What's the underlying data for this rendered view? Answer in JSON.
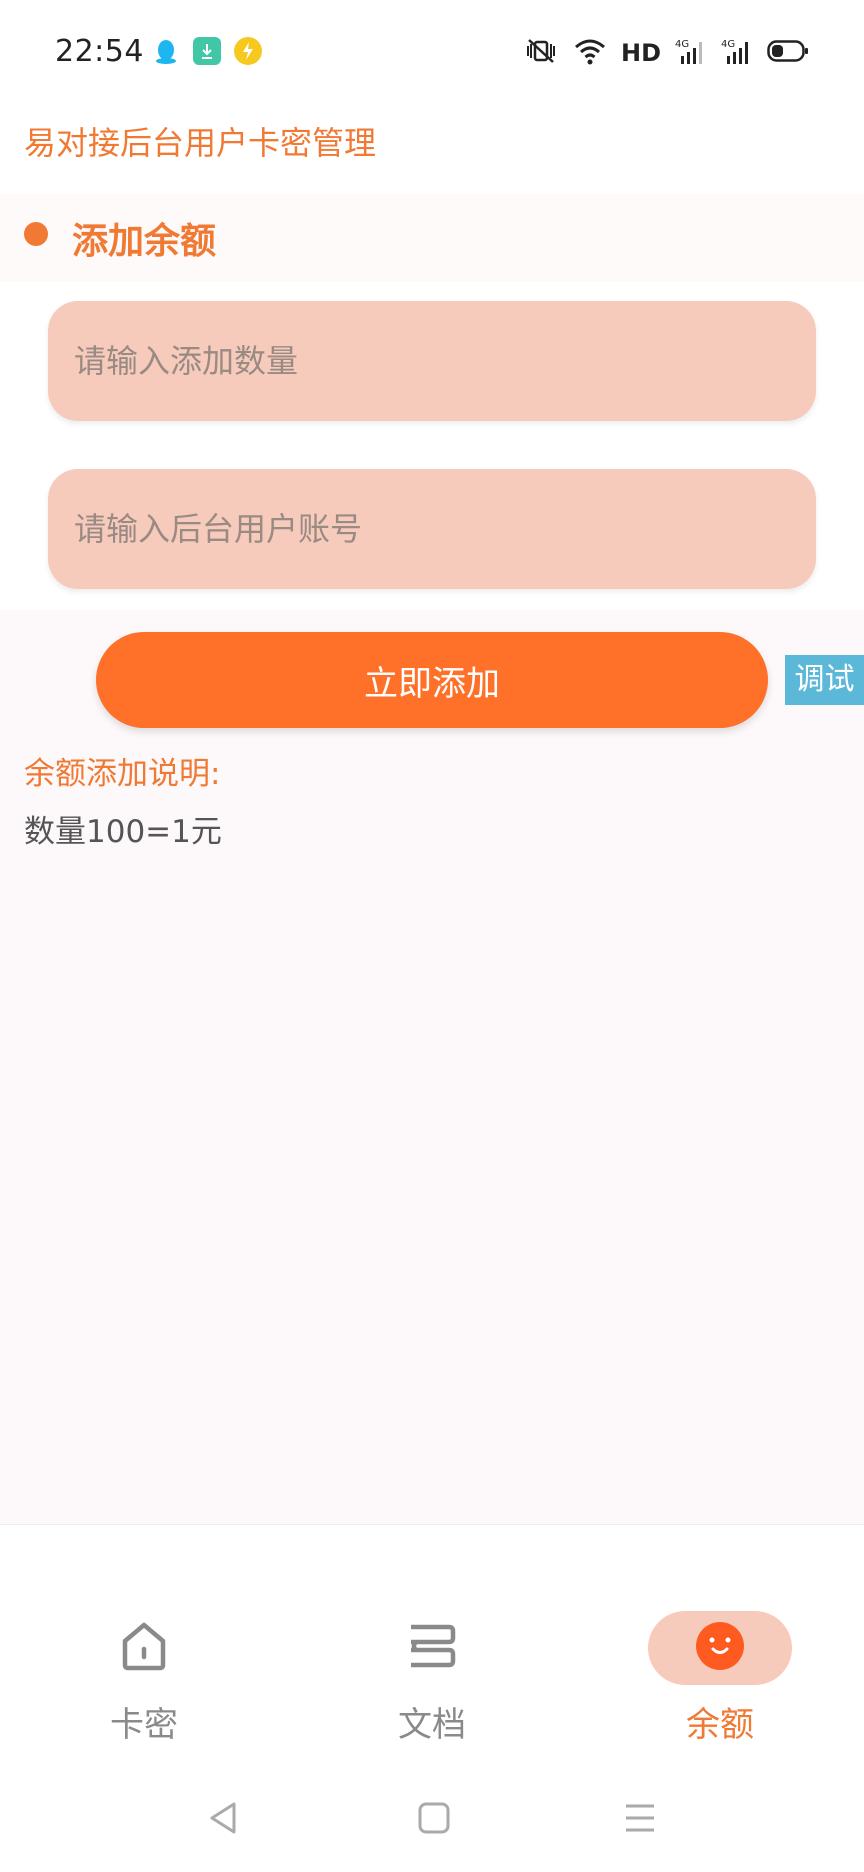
{
  "status_bar": {
    "time": "22:54",
    "app_icons": [
      "qq-icon",
      "download-icon",
      "bolt-icon"
    ],
    "network_label": "HD",
    "signal_labels": [
      "4G",
      "4G"
    ]
  },
  "header": {
    "title": "易对接后台用户卡密管理"
  },
  "section": {
    "title": "添加余额"
  },
  "form": {
    "amount_placeholder": "请输入添加数量",
    "account_placeholder": "请输入后台用户账号",
    "submit_label": "立即添加"
  },
  "debug_tab": {
    "label": "调试"
  },
  "description": {
    "title": "余额添加说明:",
    "text": "数量100=1元"
  },
  "bottom_nav": {
    "items": [
      {
        "label": "卡密",
        "icon": "home-icon",
        "active": false
      },
      {
        "label": "文档",
        "icon": "document-icon",
        "active": false
      },
      {
        "label": "余额",
        "icon": "smile-face-icon",
        "active": true
      }
    ]
  },
  "colors": {
    "accent": "#f07a34",
    "button": "#ff7028",
    "input_bg": "#f6cbbb",
    "debug_tab": "#5bb8d8"
  }
}
